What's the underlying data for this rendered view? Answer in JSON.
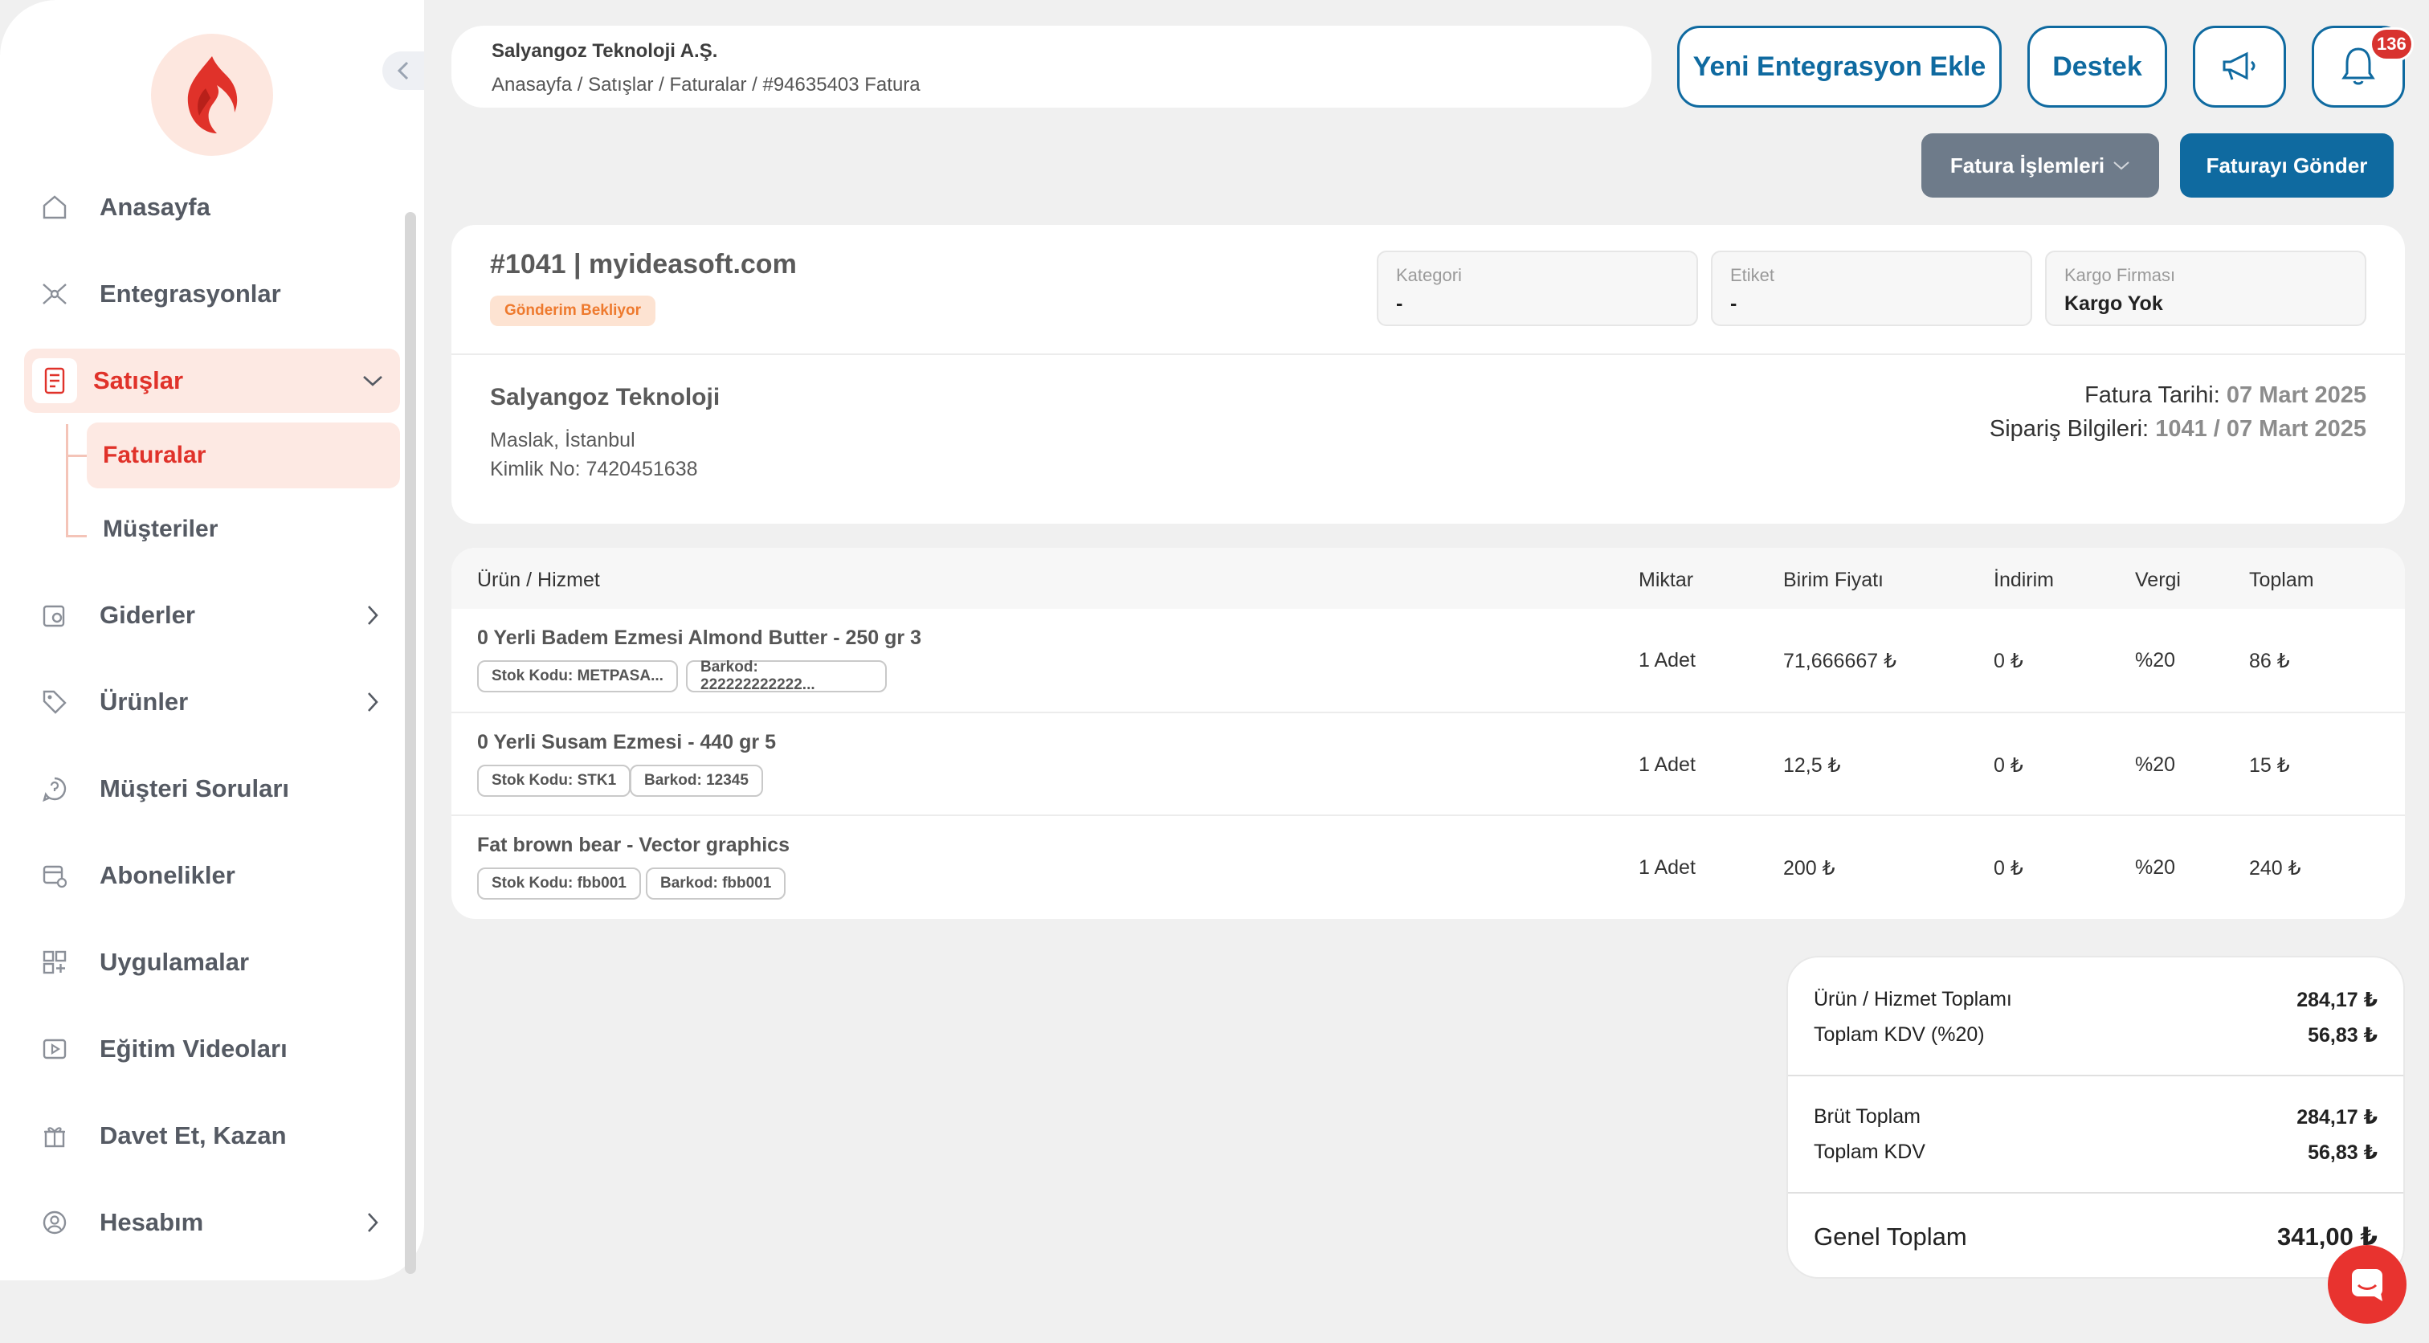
{
  "colors": {
    "brand_red": "#e0322a",
    "primary_blue": "#0f6aa0",
    "secondary_gray": "#6e7b8a",
    "status_orange": "#ee7a2e"
  },
  "sidebar": {
    "logo_icon": "flame-logo",
    "items": [
      {
        "label": "Anasayfa",
        "icon": "home-icon"
      },
      {
        "label": "Entegrasyonlar",
        "icon": "network-icon"
      },
      {
        "label": "Satışlar",
        "icon": "receipt-icon",
        "expanded": true
      },
      {
        "label": "Giderler",
        "icon": "expense-icon"
      },
      {
        "label": "Ürünler",
        "icon": "tag-icon"
      },
      {
        "label": "Müşteri Soruları",
        "icon": "chat-question-icon"
      },
      {
        "label": "Abonelikler",
        "icon": "subscription-icon"
      },
      {
        "label": "Uygulamalar",
        "icon": "apps-grid-icon"
      },
      {
        "label": "Eğitim Videoları",
        "icon": "video-icon"
      },
      {
        "label": "Davet Et, Kazan",
        "icon": "gift-icon"
      },
      {
        "label": "Hesabım",
        "icon": "user-circle-icon"
      }
    ],
    "sub_items": [
      {
        "label": "Faturalar",
        "active": true
      },
      {
        "label": "Müşteriler",
        "active": false
      }
    ]
  },
  "header": {
    "company": "Salyangoz Teknoloji A.Ş.",
    "breadcrumb": "Anasayfa / Satışlar / Faturalar / #94635403 Fatura",
    "new_integration_label": "Yeni Entegrasyon Ekle",
    "support_label": "Destek",
    "notification_count": "136"
  },
  "actions": {
    "invoice_ops_label": "Fatura İşlemleri",
    "send_invoice_label": "Faturayı Gönder"
  },
  "order": {
    "title": "#1041 | myideasoft.com",
    "status": "Gönderim Bekliyor",
    "fields": [
      {
        "label": "Kategori",
        "value": "-"
      },
      {
        "label": "Etiket",
        "value": "-"
      },
      {
        "label": "Kargo Firması",
        "value": "Kargo Yok"
      }
    ],
    "customer": {
      "name": "Salyangoz Teknoloji",
      "address": "Maslak, İstanbul",
      "tax_id": "Kimlik No: 7420451638"
    },
    "invoice_date_label": "Fatura Tarihi:",
    "invoice_date": "07 Mart 2025",
    "order_info_label": "Sipariş Bilgileri:",
    "order_info": "1041 / 07 Mart 2025"
  },
  "table": {
    "headers": [
      "Ürün / Hizmet",
      "Miktar",
      "Birim Fiyatı",
      "İndirim",
      "Vergi",
      "Toplam"
    ],
    "rows": [
      {
        "name": "0 Yerli Badem Ezmesi Almond Butter - 250 gr 3",
        "stock": "Stok Kodu: METPASA...",
        "barcode": "Barkod: 222222222222...",
        "qty": "1 Adet",
        "unit": "71,666667 ₺",
        "discount": "0 ₺",
        "tax": "%20",
        "total": "86 ₺"
      },
      {
        "name": "0 Yerli Susam Ezmesi - 440 gr 5",
        "stock": "Stok Kodu: STK1",
        "barcode": "Barkod: 12345",
        "qty": "1 Adet",
        "unit": "12,5 ₺",
        "discount": "0 ₺",
        "tax": "%20",
        "total": "15 ₺"
      },
      {
        "name": "Fat brown bear - Vector graphics",
        "stock": "Stok Kodu: fbb001",
        "barcode": "Barkod: fbb001",
        "qty": "1 Adet",
        "unit": "200 ₺",
        "discount": "0 ₺",
        "tax": "%20",
        "total": "240 ₺"
      }
    ]
  },
  "totals": {
    "items_total_label": "Ürün / Hizmet Toplamı",
    "items_total": "284,17 ₺",
    "kdv20_label": "Toplam KDV (%20)",
    "kdv20": "56,83 ₺",
    "gross_label": "Brüt Toplam",
    "gross": "284,17 ₺",
    "kdv_label": "Toplam KDV",
    "kdv": "56,83 ₺",
    "grand_label": "Genel Toplam",
    "grand": "341,00 ₺"
  }
}
